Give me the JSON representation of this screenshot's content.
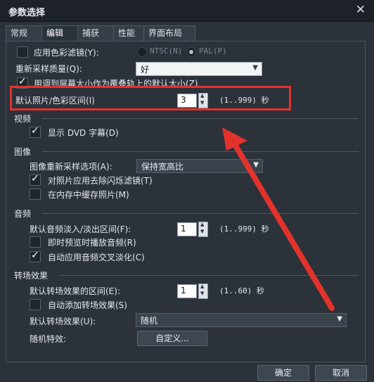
{
  "window": {
    "title": "参数选择",
    "close_glyph": "✕"
  },
  "tabs": [
    {
      "label": "常规",
      "active": false
    },
    {
      "label": "编辑",
      "active": true
    },
    {
      "label": "捕获",
      "active": false
    },
    {
      "label": "性能",
      "active": false
    },
    {
      "label": "界面布局",
      "active": false
    }
  ],
  "general": {
    "color_filter_label": "应用色彩滤镜(Y):",
    "ntsc_label": "NTSC(N)",
    "pal_label": "PAL(P)",
    "resample_label": "重新采样质量(Q):",
    "resample_value": "好",
    "fit_label": "用调到屏幕大小作为覆叠轨上的默认大小(Z)",
    "photo_duration_label": "默认照片/色彩区间(I)",
    "photo_duration_value": "3",
    "photo_duration_range": "(1..999) 秒"
  },
  "video": {
    "section_label": "视频",
    "show_dvd_label": "显示 DVD 字幕(D)"
  },
  "image": {
    "section_label": "图像",
    "resample_option_label": "图像重新采样选项(A):",
    "resample_option_value": "保持宽高比",
    "deflicker_label": "对照片应用去除闪烁滤镜(T)",
    "cache_label": "在内存中缓存照片(M)"
  },
  "audio": {
    "section_label": "音频",
    "fade_label": "默认音频淡入/淡出区间(F):",
    "fade_value": "1",
    "fade_range": "(1..999) 秒",
    "preview_label": "即时预览时播放音频(R)",
    "crossfade_label": "自动应用音频交叉淡化(C)"
  },
  "transition": {
    "section_label": "转场效果",
    "duration_label": "默认转场效果的区间(E):",
    "duration_value": "1",
    "duration_range": "(1..60) 秒",
    "auto_add_label": "自动添加转场效果(S)",
    "default_label": "默认转场效果(U):",
    "default_value": "随机",
    "random_label": "随机特效:",
    "custom_button": "自定义..."
  },
  "footer": {
    "ok": "确定",
    "cancel": "取消"
  },
  "colors": {
    "annotation_red": "#e3322c",
    "dialog_bg": "#2b323a"
  }
}
